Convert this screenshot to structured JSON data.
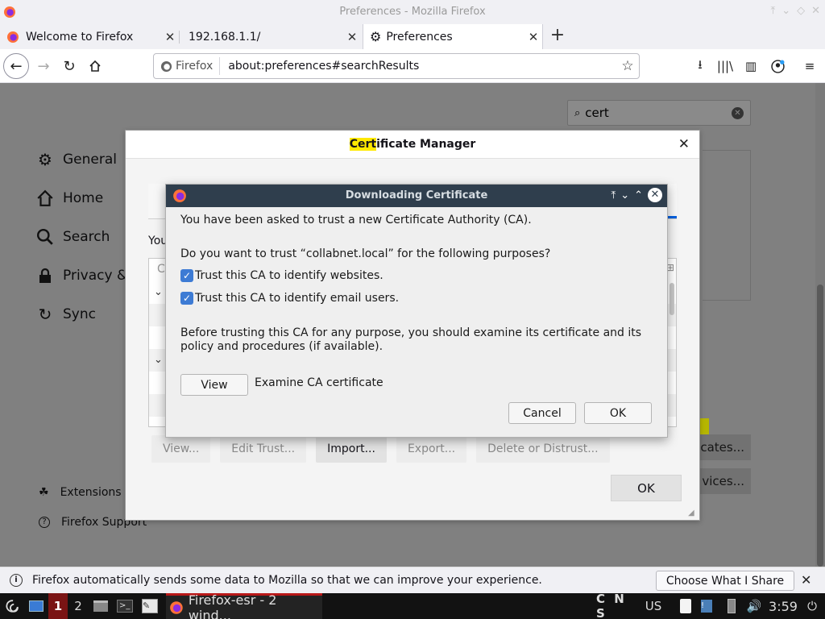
{
  "window": {
    "title": "Preferences - Mozilla Firefox"
  },
  "tabs": [
    {
      "label": "Welcome to Firefox"
    },
    {
      "label": "192.168.1.1/"
    },
    {
      "label": "Preferences"
    }
  ],
  "urlbar": {
    "identity": "Firefox",
    "url": "about:preferences#searchResults"
  },
  "prefs": {
    "search_value": "cert",
    "sidebar": [
      "General",
      "Home",
      "Search",
      "Privacy &",
      "Sync"
    ],
    "footer": [
      "Extensions &",
      "Firefox Support"
    ],
    "right_btn_1": "cates...",
    "right_btn_2": "vices..."
  },
  "cert_manager": {
    "title_highlight": "Cert",
    "title_rest": "ificate Manager",
    "you_text": "You",
    "col_head": "C",
    "buttons": [
      "View...",
      "Edit Trust...",
      "Import...",
      "Export...",
      "Delete or Distrust..."
    ],
    "ok": "OK"
  },
  "download_dialog": {
    "title": "Downloading Certificate",
    "line1": "You have been asked to trust a new Certificate Authority (CA).",
    "line2": "Do you want to trust “collabnet.local” for the following purposes?",
    "check1": "Trust this CA to identify websites.",
    "check2": "Trust this CA to identify email users.",
    "line3a": "Before trusting this CA for any purpose, you should examine its certificate and its",
    "line3b": "policy and procedures (if available).",
    "view_btn": "View",
    "examine": "Examine CA certificate",
    "cancel": "Cancel",
    "ok": "OK"
  },
  "notification": {
    "message": "Firefox automatically sends some data to Mozilla so that we can improve your experience.",
    "button": "Choose What I Share"
  },
  "taskbar": {
    "ws1": "1",
    "ws2": "2",
    "task": "Firefox-esr - 2 wind...",
    "indicators": "C N S",
    "layout": "US",
    "clock": "3:59"
  },
  "colors": {
    "dialog_header": "#2f3e4d",
    "checkbox": "#3d7bd4",
    "highlight": "#ffe900",
    "taskbar_active": "#7a1414"
  }
}
